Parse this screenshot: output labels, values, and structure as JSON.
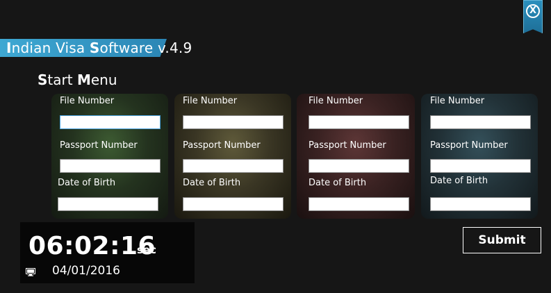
{
  "window": {
    "close_glyph": "X",
    "title_parts": [
      "I",
      "ndian Visa ",
      "S",
      "oftware v.4.9"
    ]
  },
  "menu": {
    "title_parts": [
      "S",
      "tart ",
      "M",
      "enu"
    ]
  },
  "cards": [
    {
      "file_label": "File Number",
      "passport_label": "Passport Number",
      "dob_label": "Date of Birth",
      "file_value": "",
      "passport_value": "",
      "dob_value": ""
    },
    {
      "file_label": "File Number",
      "passport_label": "Passport Number",
      "dob_label": "Date of Birth",
      "file_value": "",
      "passport_value": "",
      "dob_value": ""
    },
    {
      "file_label": "File Number",
      "passport_label": "Passport Number",
      "dob_label": "Date of Birth",
      "file_value": "",
      "passport_value": "",
      "dob_value": ""
    },
    {
      "file_label": "File Number",
      "passport_label": "Passport Number",
      "dob_label": "Date of Birth",
      "file_value": "",
      "passport_value": "",
      "dob_value": ""
    }
  ],
  "clock": {
    "time": "06:02:16",
    "unit": "sec",
    "date": "04/01/2016",
    "icon": "monitor-icon"
  },
  "actions": {
    "submit_label": "Submit"
  },
  "colors": {
    "background": "#161616",
    "accent": "#3ea8d3",
    "card_green": "#3d5b32",
    "card_olive": "#5f5a3a",
    "card_maroon": "#5d3636",
    "card_teal": "#34505a"
  }
}
